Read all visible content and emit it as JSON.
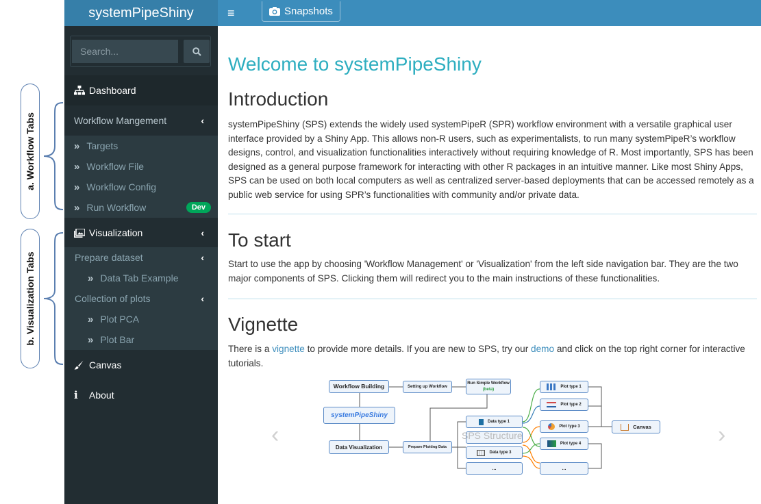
{
  "annotations": {
    "workflow_tabs": "a. Workflow Tabs",
    "visualization_tabs": "b. Visualization Tabs"
  },
  "header": {
    "brand": "systemPipeShiny",
    "menu_glyph": "≡",
    "snapshots_label": "Snapshots"
  },
  "sidebar": {
    "search_placeholder": "Search...",
    "dashboard": "Dashboard",
    "workflow_management": "Workflow Mangement",
    "workflow_items": [
      "Targets",
      "Workflow File",
      "Workflow Config",
      "Run Workflow"
    ],
    "dev_badge": "Dev",
    "visualization": "Visualization",
    "prepare_dataset": "Prepare dataset",
    "data_tab_example": "Data Tab Example",
    "collection_of_plots": "Collection of plots",
    "plot_items": [
      "Plot PCA",
      "Plot Bar"
    ],
    "canvas": "Canvas",
    "about": "About"
  },
  "main": {
    "welcome": "Welcome to systemPipeShiny",
    "intro_title": "Introduction",
    "intro_text": "systemPipeShiny (SPS) extends the widely used systemPipeR (SPR) workflow environment with a versatile graphical user interface provided by a Shiny App. This allows non-R users, such as experimentalists, to run many systemPipeR’s workflow designs, control, and visualization functionalities interactively without requiring knowledge of R. Most importantly, SPS has been designed as a general purpose framework for interacting with other R packages in an intuitive manner. Like most Shiny Apps, SPS can be used on both local computers as well as centralized server-based deployments that can be accessed remotely as a public web service for using SPR’s functionalities with community and/or private data.",
    "start_title": "To start",
    "start_text": "Start to use the app by choosing 'Workflow Management' or 'Visualization' from the left side navigation bar. They are the two major components of SPS. Clicking them will redirect you to the main instructions of these functionalities.",
    "vignette_title": "Vignette",
    "vignette_pre": "There is a ",
    "vignette_link": "vignette",
    "vignette_mid": " to provide more details. If you are new to SPS, try our ",
    "demo_link": "demo",
    "vignette_post": " and click on the top right corner for interactive tutorials."
  },
  "diagram": {
    "workflow_building": "Workflow Building",
    "setting_up_workflow": "Setting up Workflow",
    "run_simple_workflow": "Run Simple Workflow",
    "beta": "(beta)",
    "sps": "systemPipeShiny",
    "data_visualization": "Data Visualization",
    "prepare_plotting_data": "Prepare Plotting Data",
    "data_types": [
      "Data type 1",
      "Data type 3",
      "..."
    ],
    "plot_types": [
      "Plot type 1",
      "Plot type 2",
      "Plot type 3",
      "Plot type 4",
      "..."
    ],
    "canvas": "Canvas",
    "watermark": "SPS Structure"
  },
  "colors": {
    "header_dark": "#367fa9",
    "header": "#3c8dbc",
    "sidebar": "#222d32",
    "submenu": "#2c3b41",
    "accent_title": "#2eaec0",
    "dev_badge": "#00a65a"
  }
}
